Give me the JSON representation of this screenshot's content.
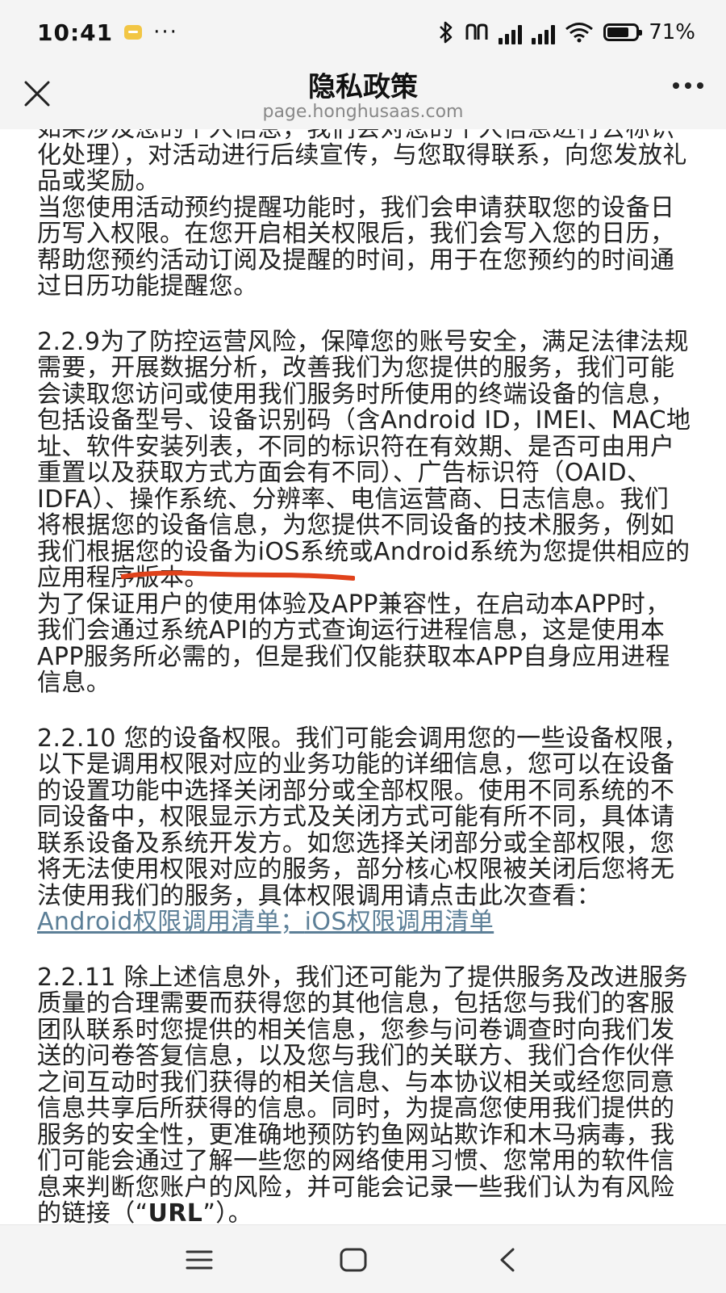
{
  "status_bar": {
    "time": "10:41",
    "more": "···",
    "battery_text": "71%"
  },
  "header": {
    "title": "隐私政策",
    "url": "page.honghusaas.com"
  },
  "content": {
    "p1": "如果涉及您的个人信息，我们会对您的个人信息进行去标识化处理），对活动进行后续宣传，与您取得联系，向您发放礼品或奖励。",
    "p2": "当您使用活动预约提醒功能时，我们会申请获取您的设备日历写入权限。在您开启相关权限后，我们会写入您的日历，帮助您预约活动订阅及提醒的时间，用于在您预约的时间通过日历功能提醒您。",
    "p3": "2.2.9为了防控运营风险，保障您的账号安全，满足法律法规需要，开展数据分析，改善我们为您提供的服务，我们可能会读取您访问或使用我们服务时所使用的终端设备的信息，包括设备型号、设备识别码（含Android ID，IMEI、MAC地址、软件安装列表，不同的标识符在有效期、是否可由用户重置以及获取方式方面会有不同）、广告标识符（OAID、IDFA）、操作系统、分辨率、电信运营商、日志信息。我们将根据您的设备信息，为您提供不同设备的技术服务，例如我们根据您的设备为iOS系统或Android系统为您提供相应的应用程序版本。",
    "p4": "为了保证用户的使用体验及APP兼容性，在启动本APP时，我们会通过系统API的方式查询运行进程信息，这是使用本APP服务所必需的，但是我们仅能获取本APP自身应用进程信息。",
    "p5_text": "2.2.10 您的设备权限。我们可能会调用您的一些设备权限，以下是调用权限对应的业务功能的详细信息，您可以在设备的设置功能中选择关闭部分或全部权限。使用不同系统的不同设备中，权限显示方式及关闭方式可能有所不同，具体请联系设备及系统开发方。如您选择关闭部分或全部权限，您将无法使用权限对应的服务，部分核心权限被关闭后您将无法使用我们的服务，具体权限调用请点击此次查看：",
    "link_android": "Android权限调用清单",
    "link_sep": "；",
    "link_ios": "iOS权限调用清单",
    "p6_text": "2.2.11 除上述信息外，我们还可能为了提供服务及改进服务质量的合理需要而获得您的其他信息，包括您与我们的客服团队联系时您提供的相关信息，您参与问卷调查时向我们发送的问卷答复信息，以及您与我们的关联方、我们合作伙伴之间互动时我们获得的相关信息、与本协议相关或经您同意信息共享后所获得的信息。同时，为提高您使用我们提供的服务的安全性，更准确地预防钓鱼网站欺诈和木马病毒，我们可能会通过了解一些您的网络使用习惯、您常用的软件信息来判断您账户的风险，并可能会记录一些我们认为有风险的链接（“",
    "p6_bold": "URL",
    "p6_end": "”）。"
  },
  "colors": {
    "link": "#5c7f97",
    "annotation": "#e0421b"
  }
}
